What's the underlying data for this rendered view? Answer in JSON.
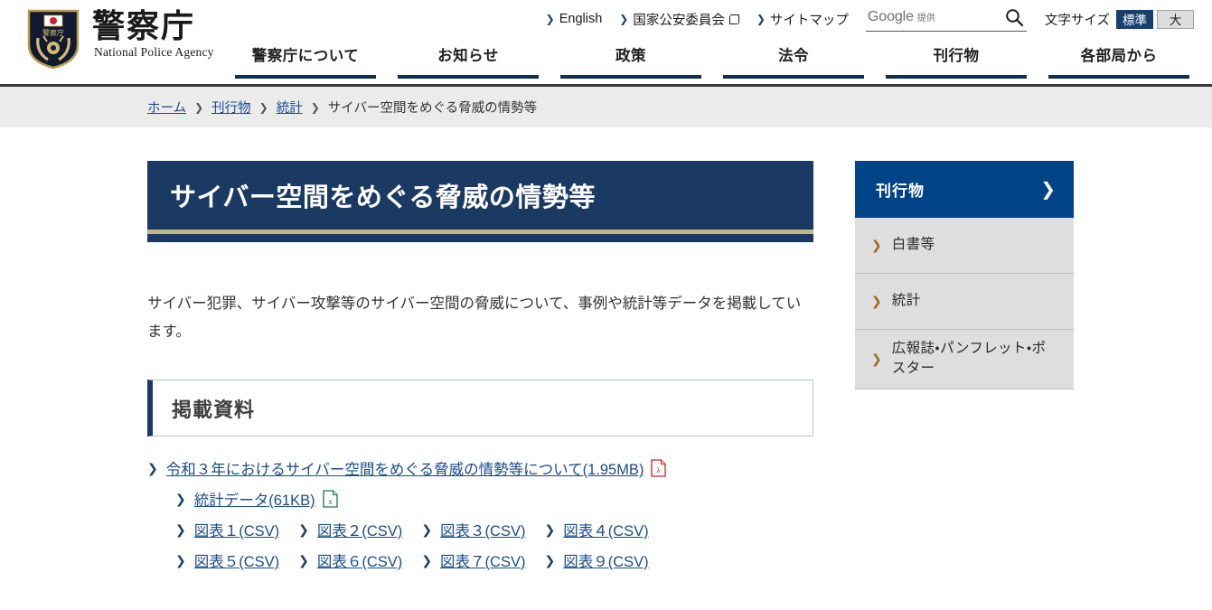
{
  "header": {
    "logo_title": "警察庁",
    "logo_subtitle": "National Police Agency",
    "utility_links": [
      {
        "label": "English",
        "external": false
      },
      {
        "label": "国家公安委員会",
        "external": true
      },
      {
        "label": "サイトマップ",
        "external": false
      }
    ],
    "search": {
      "placeholder": "Google 提供",
      "placeholder_main": "Google",
      "placeholder_sub": "提供",
      "value": "",
      "button_icon": "search-icon"
    },
    "fontsize": {
      "label": "文字サイズ",
      "options": [
        {
          "label": "標準",
          "selected": true
        },
        {
          "label": "大",
          "selected": false
        }
      ]
    },
    "global_nav": [
      {
        "label": "警察庁について"
      },
      {
        "label": "お知らせ"
      },
      {
        "label": "政策"
      },
      {
        "label": "法令"
      },
      {
        "label": "刊行物"
      },
      {
        "label": "各部局から"
      }
    ]
  },
  "breadcrumb": {
    "items": [
      {
        "label": "ホーム",
        "link": true
      },
      {
        "label": "刊行物",
        "link": true
      },
      {
        "label": "統計",
        "link": true
      },
      {
        "label": "サイバー空間をめぐる脅威の情勢等",
        "link": false
      }
    ],
    "separator": "❯"
  },
  "main": {
    "page_title": "サイバー空間をめぐる脅威の情勢等",
    "lead_text": "サイバー犯罪、サイバー攻撃等のサイバー空間の脅威について、事例や統計等データを掲載しています。",
    "section_heading": "掲載資料",
    "primary_document": {
      "label": "令和３年におけるサイバー空間をめぐる脅威の情勢等について(1.95MB)",
      "icon": "pdf-icon"
    },
    "excel_document": {
      "label": "統計データ(61KB)",
      "icon": "excel-icon"
    },
    "csv_rows": [
      [
        {
          "label": "図表１(CSV)"
        },
        {
          "label": "図表２(CSV)"
        },
        {
          "label": "図表３(CSV)"
        },
        {
          "label": "図表４(CSV)"
        }
      ],
      [
        {
          "label": "図表５(CSV)"
        },
        {
          "label": "図表６(CSV)"
        },
        {
          "label": "図表７(CSV)"
        },
        {
          "label": "図表９(CSV)"
        }
      ]
    ]
  },
  "sidebar": {
    "header_label": "刊行物",
    "header_chevron": "❯",
    "items": [
      {
        "label": "白書等"
      },
      {
        "label": "統計"
      },
      {
        "label": "広報誌・パンフレット・ポスター"
      }
    ]
  },
  "colors": {
    "navy": "#1b3a63",
    "sidebar_blue": "#004386",
    "gold": "#c4b581",
    "link_blue": "#1a4b8c",
    "breadcrumb_bg": "#ebebeb",
    "sidebar_item_bg": "#dedede",
    "pdf_red": "#cc2229",
    "excel_green": "#1f7a46",
    "chevron_orange": "#a06a1e"
  }
}
